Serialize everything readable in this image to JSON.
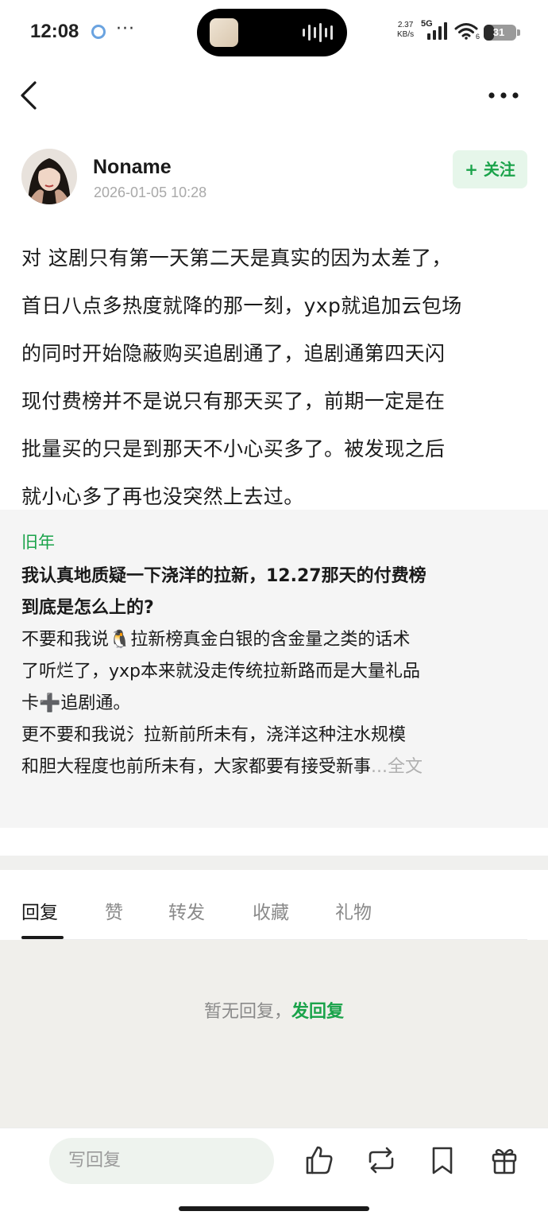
{
  "status_bar": {
    "time": "12:08",
    "more_dots": "···",
    "net_speed_value": "2.37",
    "net_speed_unit": "KB/s",
    "network": "5G",
    "wifi_badge": "6",
    "battery_text": "31",
    "battery_level": 0.31
  },
  "nav": {
    "back_icon": "chevron-left-icon",
    "more_icon": "more-horizontal-icon"
  },
  "author": {
    "name": "Noname",
    "time": "2026-01-05 10:28",
    "follow_label": "+ 关注"
  },
  "post": {
    "lines": [
      "对 这剧只有第一天第二天是真实的因为太差了，",
      "首日八点多热度就降的那一刻，yxp就追加云包场",
      "的同时开始隐蔽购买追剧通了，追剧通第四天闪",
      "现付费榜并不是说只有那天买了，前期一定是在",
      "批量买的只是到那天不小心买多了。被发现之后",
      "就小心多了再也没突然上去过。"
    ]
  },
  "quote": {
    "user": "旧年",
    "title_line1": "我认真地质疑一下浇洋的拉新，12.27那天的付费榜",
    "title_line2": "到底是怎么上的?",
    "body_line1": "不要和我说🐧拉新榜真金白银的含金量之类的话术",
    "body_line2": "了听烂了，yxp本来就没走传统拉新路而是大量礼品",
    "body_line3": "卡➕追剧通。",
    "body_line4": "更不要和我说氵拉新前所未有，浇洋这种注水规模",
    "body_line5": "和胆大程度也前所未有，大家都要有接受新事",
    "full_text_link": "...全文"
  },
  "tabs": [
    {
      "label": "回复",
      "active": true
    },
    {
      "label": "赞",
      "active": false
    },
    {
      "label": "转发",
      "active": false
    },
    {
      "label": "收藏",
      "active": false
    },
    {
      "label": "礼物",
      "active": false
    }
  ],
  "replies": {
    "empty_text": "暂无回复，",
    "empty_link": "发回复"
  },
  "bottom_bar": {
    "input_placeholder": "写回复",
    "icons": [
      "thumbs-up-icon",
      "repost-icon",
      "bookmark-icon",
      "gift-icon"
    ]
  },
  "colors": {
    "accent_green": "#1aa34a",
    "follow_bg": "#e6f6ea",
    "quote_bg": "#f5f5f5",
    "reply_area_bg": "#f0efeb"
  }
}
